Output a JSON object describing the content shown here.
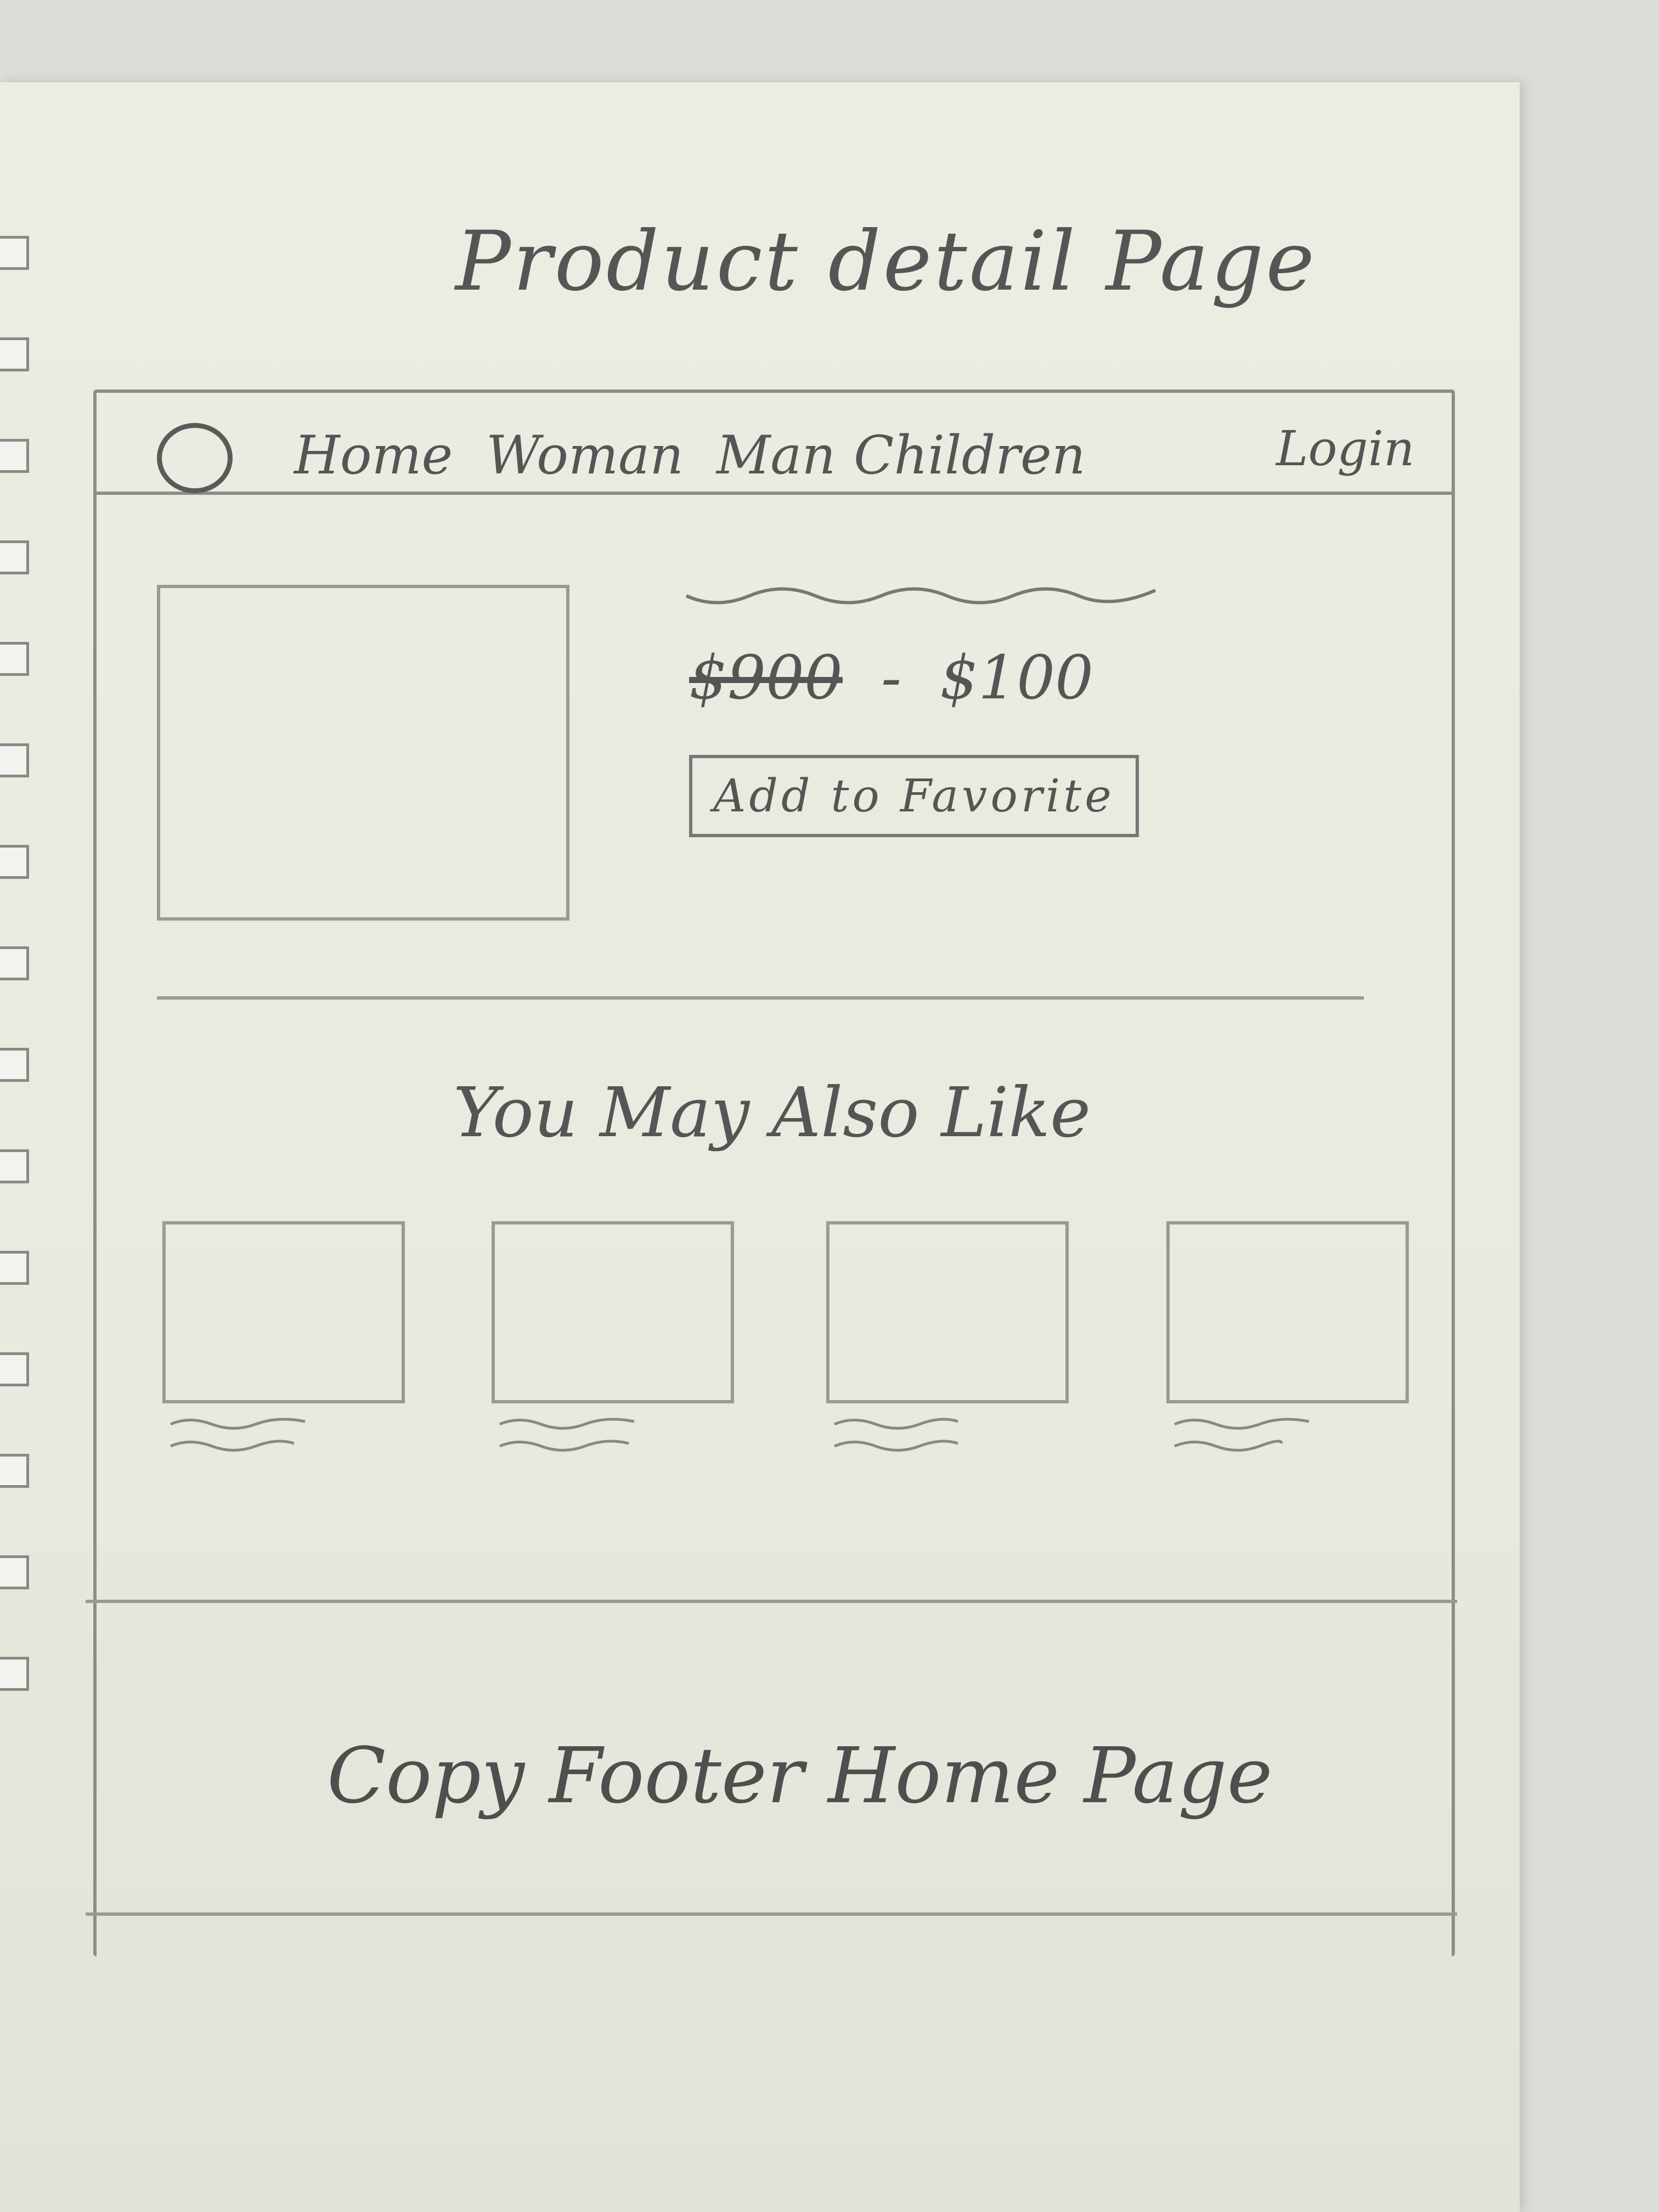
{
  "sketch_title": "Product detail Page",
  "navbar": {
    "logo_icon": "circle-logo-icon",
    "items": [
      "Home",
      "Woman",
      "Man",
      "Children"
    ],
    "login": "Login"
  },
  "product": {
    "image_icon": "image-placeholder-icon",
    "old_price": "$900",
    "separator": "-",
    "price": "$100",
    "favorite_button": "Add to Favorite"
  },
  "recommendations": {
    "title": "You May Also Like",
    "card_count_note": "four placeholder product cards"
  },
  "footer": {
    "text": "Copy Footer Home Page"
  },
  "colors": {
    "paper": "#ecece2",
    "pencil": "#5a5a5a",
    "background": "#dcdcd8"
  }
}
